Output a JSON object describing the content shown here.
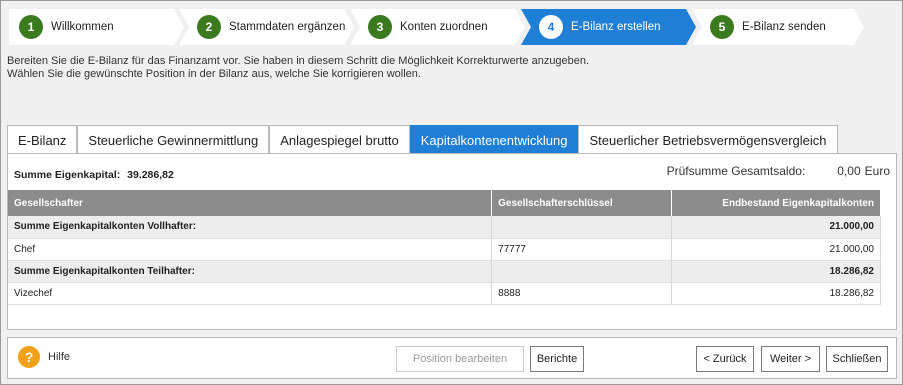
{
  "steps": [
    {
      "num": "1",
      "label": "Willkommen"
    },
    {
      "num": "2",
      "label": "Stammdaten ergänzen"
    },
    {
      "num": "3",
      "label": "Konten zuordnen"
    },
    {
      "num": "4",
      "label": "E-Bilanz erstellen"
    },
    {
      "num": "5",
      "label": "E-Bilanz senden"
    }
  ],
  "intro": {
    "line1": "Bereiten Sie die E-Bilanz für das Finanzamt vor. Sie haben in diesem Schritt die Möglichkeit Korrekturwerte anzugeben.",
    "line2": "Wählen Sie die gewünschte Position in der Bilanz aus, welche Sie korrigieren wollen."
  },
  "tabs": [
    "E-Bilanz",
    "Steuerliche Gewinnermittlung",
    "Anlagespiegel brutto",
    "Kapitalkontenentwicklung",
    "Steuerlicher Betriebsvermögensvergleich"
  ],
  "summary": {
    "label": "Summe Eigenkapital:",
    "value": "39.286,82",
    "check_label": "Prüfsumme Gesamtsaldo:",
    "check_value": "0,00",
    "check_unit": "Euro"
  },
  "table": {
    "headers": [
      "Gesellschafter",
      "Gesellschafterschlüssel",
      "Endbestand Eigenkapitalkonten"
    ],
    "rows": [
      {
        "name": "Summe Eigenkapitalkonten Vollhafter:",
        "key": "",
        "amount": "21.000,00"
      },
      {
        "name": "Chef",
        "key": "77777",
        "amount": "21.000,00"
      },
      {
        "name": "Summe Eigenkapitalkonten Teilhafter:",
        "key": "",
        "amount": "18.286,82"
      },
      {
        "name": "Vizechef",
        "key": "8888",
        "amount": "18.286,82"
      }
    ]
  },
  "footer": {
    "help": "Hilfe",
    "edit": "Position bearbeiten",
    "reports": "Berichte",
    "back": "< Zurück",
    "next": "Weiter >",
    "close": "Schließen"
  }
}
